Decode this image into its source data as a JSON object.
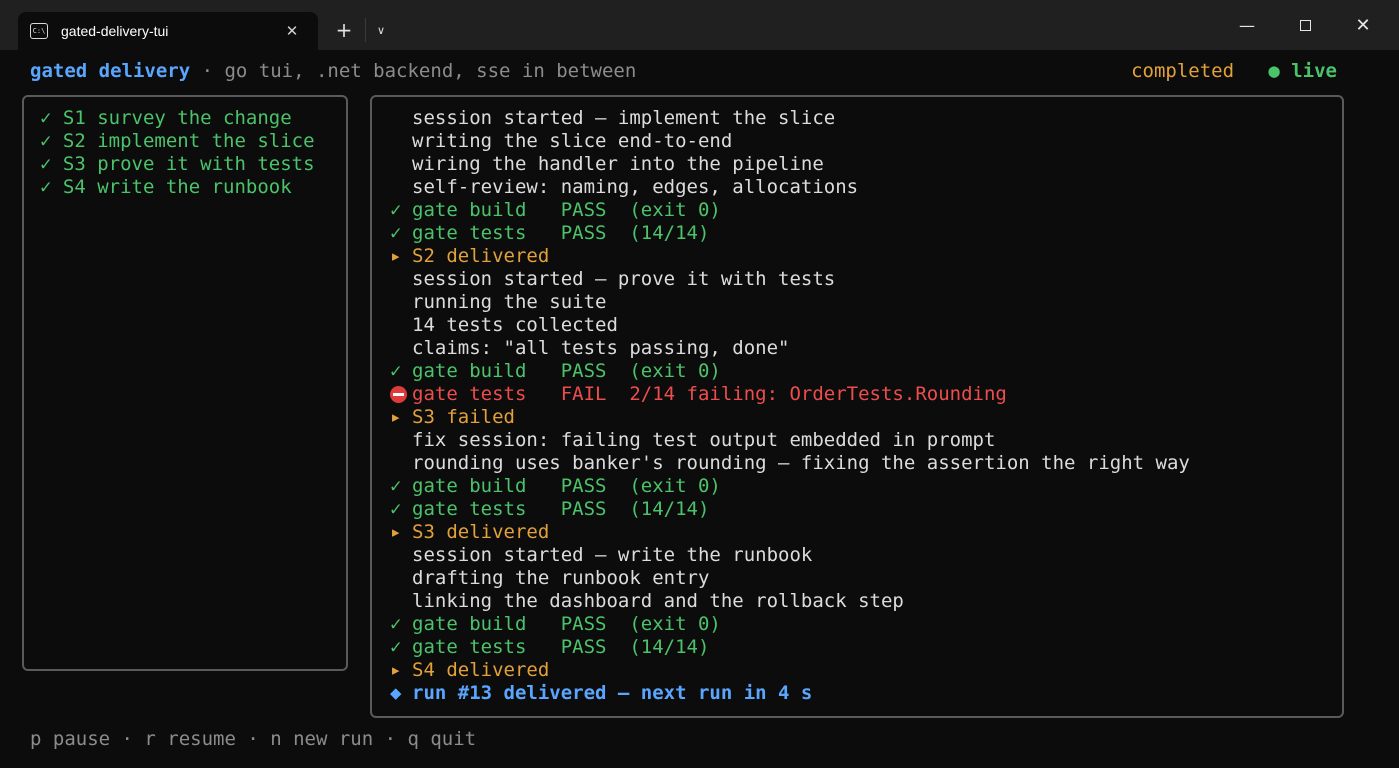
{
  "window": {
    "tab_title": "gated-delivery-tui",
    "tab_icon": "terminal-icon",
    "new_tab": "+",
    "dropdown": "⌄",
    "minimize": "—",
    "close": "✕"
  },
  "header": {
    "brand": "gated delivery",
    "subtitle": " · go tui, .net backend, sse in between",
    "status": "completed",
    "live_dot": "●",
    "live_label": " live"
  },
  "colors": {
    "accent_blue": "#5aa6ff",
    "pass_green": "#4bc36a",
    "fail_red": "#ee4d4d",
    "stage_orange": "#e2a13b",
    "muted": "#8c8c8c"
  },
  "steps": [
    {
      "mark": "✓",
      "label": "S1 survey the change"
    },
    {
      "mark": "✓",
      "label": "S2 implement the slice"
    },
    {
      "mark": "✓",
      "label": "S3 prove it with tests"
    },
    {
      "mark": "✓",
      "label": "S4 write the runbook"
    }
  ],
  "log": [
    {
      "type": "info",
      "mark": "",
      "text": "session started — implement the slice"
    },
    {
      "type": "info",
      "mark": "",
      "text": "writing the slice end-to-end"
    },
    {
      "type": "info",
      "mark": "",
      "text": "wiring the handler into the pipeline"
    },
    {
      "type": "info",
      "mark": "",
      "text": "self-review: naming, edges, allocations"
    },
    {
      "type": "pass",
      "mark": "✓",
      "text": "gate build   PASS  (exit 0)"
    },
    {
      "type": "pass",
      "mark": "✓",
      "text": "gate tests   PASS  (14/14)"
    },
    {
      "type": "stage",
      "mark": "▸",
      "text": "S2 delivered"
    },
    {
      "type": "info",
      "mark": "",
      "text": "session started — prove it with tests"
    },
    {
      "type": "info",
      "mark": "",
      "text": "running the suite"
    },
    {
      "type": "info",
      "mark": "",
      "text": "14 tests collected"
    },
    {
      "type": "info",
      "mark": "",
      "text": "claims: \"all tests passing, done\""
    },
    {
      "type": "pass",
      "mark": "✓",
      "text": "gate build   PASS  (exit 0)"
    },
    {
      "type": "fail",
      "mark": "⛔",
      "text": "gate tests   FAIL  2/14 failing: OrderTests.Rounding"
    },
    {
      "type": "stage",
      "mark": "▸",
      "text": "S3 failed"
    },
    {
      "type": "info",
      "mark": "",
      "text": "fix session: failing test output embedded in prompt"
    },
    {
      "type": "info",
      "mark": "",
      "text": "rounding uses banker's rounding — fixing the assertion the right way"
    },
    {
      "type": "pass",
      "mark": "✓",
      "text": "gate build   PASS  (exit 0)"
    },
    {
      "type": "pass",
      "mark": "✓",
      "text": "gate tests   PASS  (14/14)"
    },
    {
      "type": "stage",
      "mark": "▸",
      "text": "S3 delivered"
    },
    {
      "type": "info",
      "mark": "",
      "text": "session started — write the runbook"
    },
    {
      "type": "info",
      "mark": "",
      "text": "drafting the runbook entry"
    },
    {
      "type": "info",
      "mark": "",
      "text": "linking the dashboard and the rollback step"
    },
    {
      "type": "pass",
      "mark": "✓",
      "text": "gate build   PASS  (exit 0)"
    },
    {
      "type": "pass",
      "mark": "✓",
      "text": "gate tests   PASS  (14/14)"
    },
    {
      "type": "stage",
      "mark": "▸",
      "text": "S4 delivered"
    },
    {
      "type": "final",
      "mark": "◆",
      "text": "run #13 delivered — next run in 4 s"
    }
  ],
  "footer": "p pause · r resume · n new run · q quit"
}
